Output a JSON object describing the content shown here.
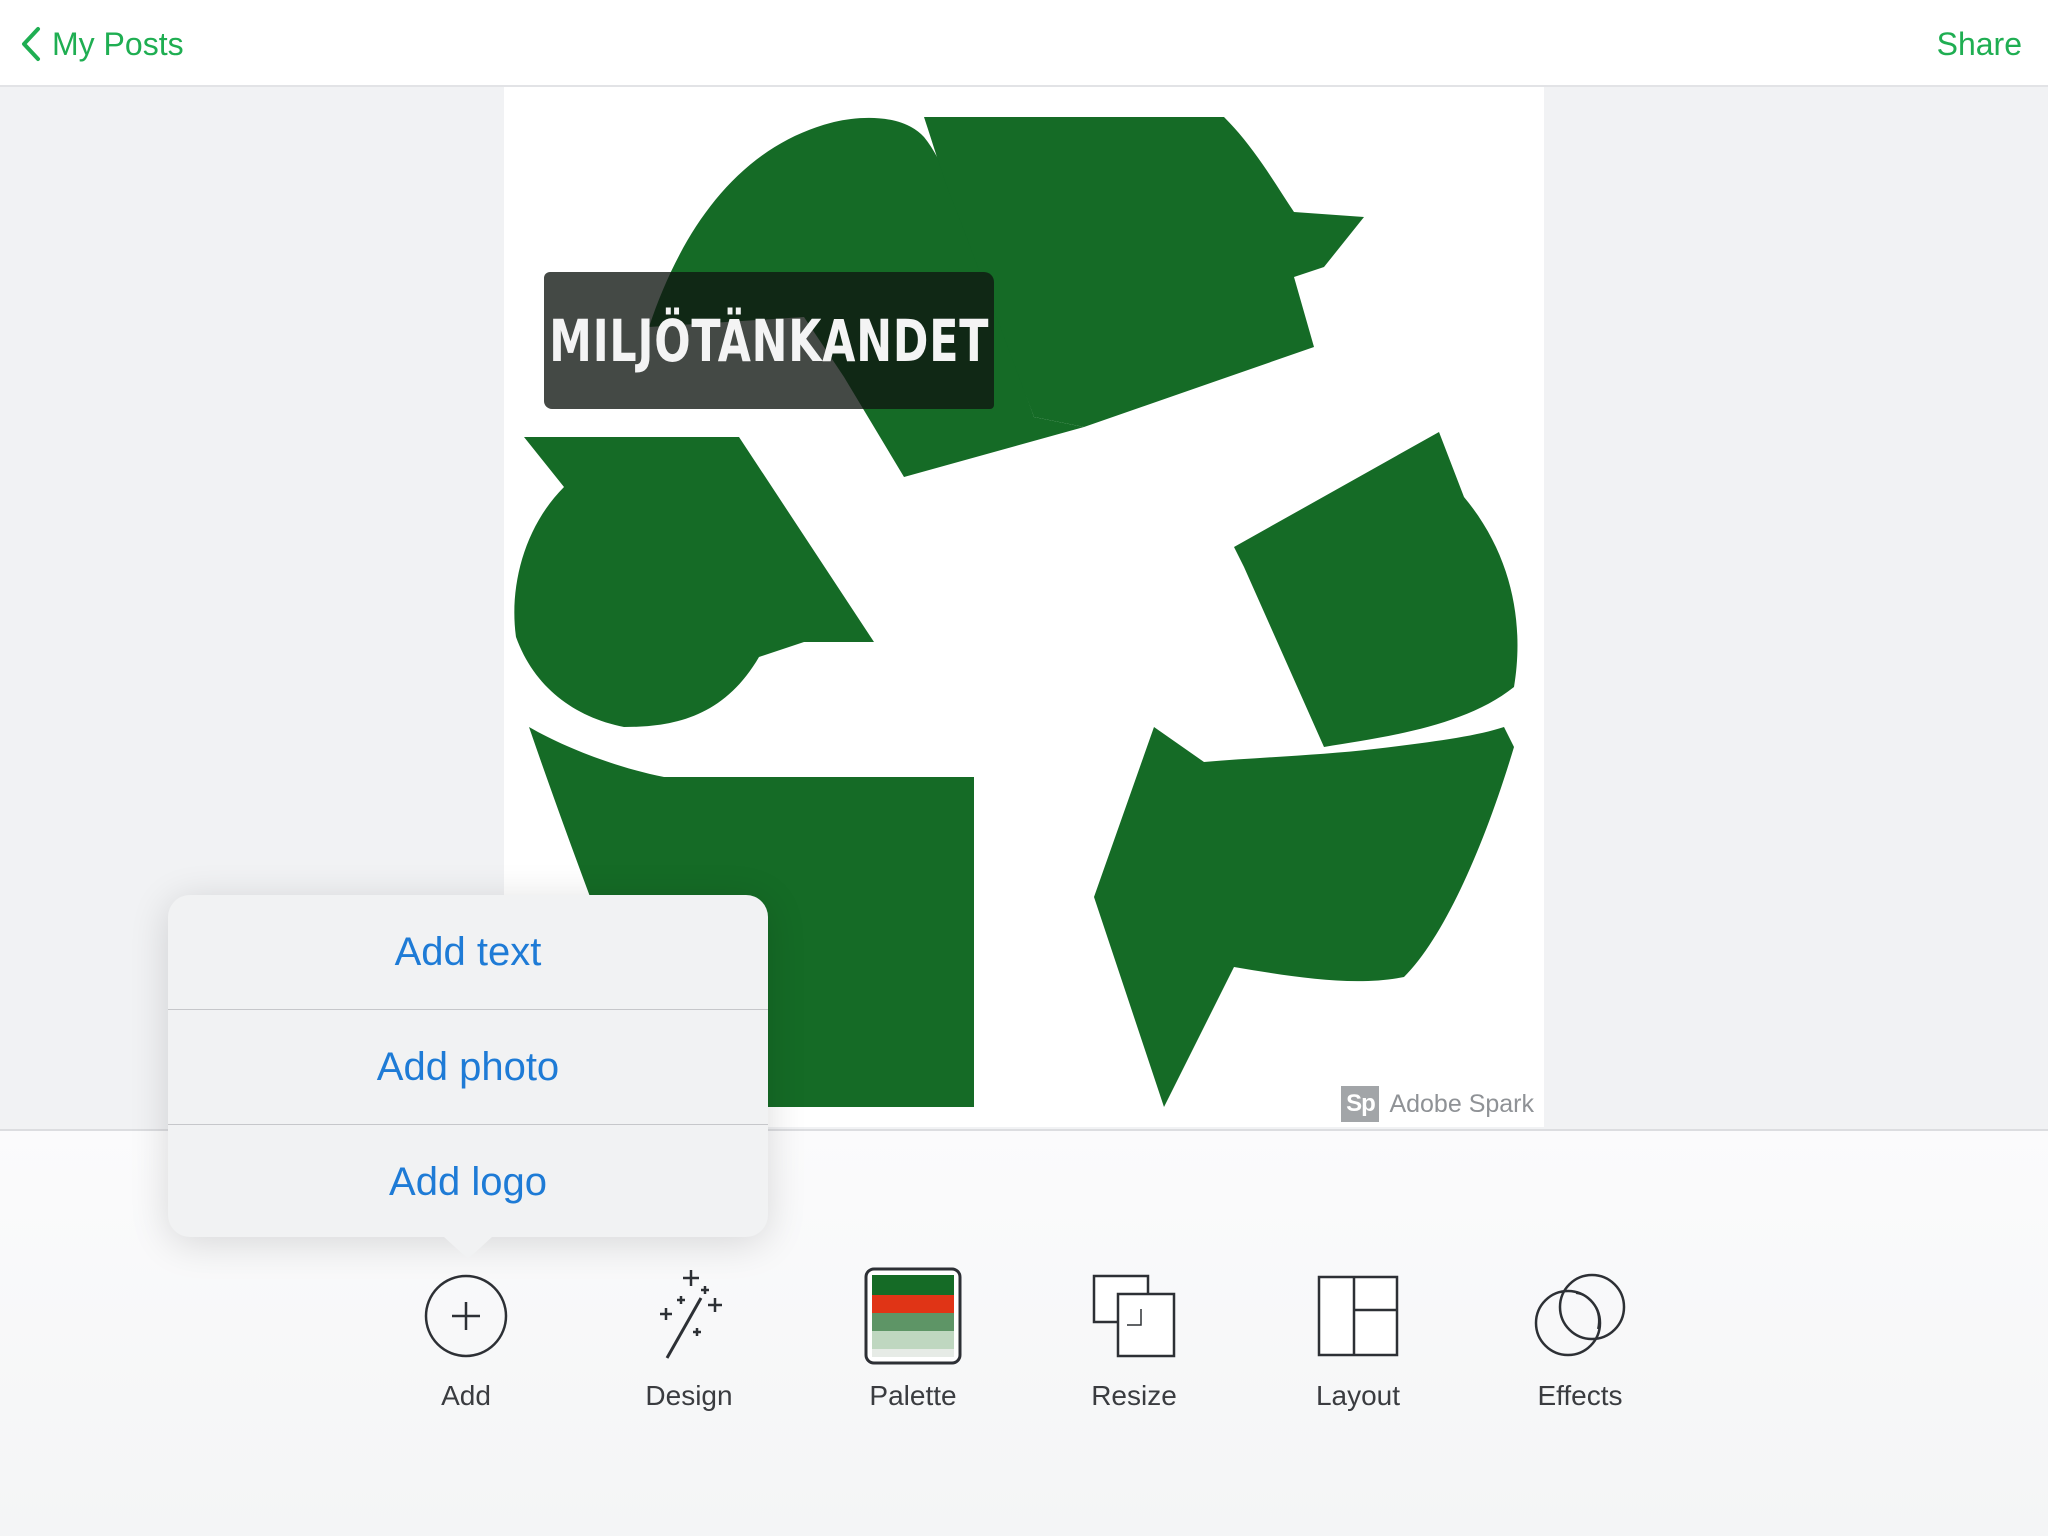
{
  "nav": {
    "back_label": "My Posts",
    "share_label": "Share"
  },
  "canvas": {
    "title_text": "MILJÖTÄNKANDET",
    "watermark_logo": "Sp",
    "watermark_text": "Adobe Spark",
    "image_icon": "recycle-symbol",
    "colors": {
      "recycle_green": "#156b26",
      "title_bg": "#1f2a22"
    }
  },
  "add_menu": {
    "items": [
      {
        "label": "Add text"
      },
      {
        "label": "Add photo"
      },
      {
        "label": "Add logo"
      }
    ]
  },
  "toolbar": {
    "tools": [
      {
        "label": "Add",
        "icon": "plus-circle-icon"
      },
      {
        "label": "Design",
        "icon": "magic-wand-icon"
      },
      {
        "label": "Palette",
        "icon": "palette-icon"
      },
      {
        "label": "Resize",
        "icon": "resize-icon"
      },
      {
        "label": "Layout",
        "icon": "layout-icon"
      },
      {
        "label": "Effects",
        "icon": "effects-icon"
      }
    ],
    "palette_colors": [
      "#156b26",
      "#e03416",
      "#5e9566",
      "#bfd7c0"
    ]
  },
  "colors": {
    "accent_green": "#1fae52",
    "menu_blue": "#1e7bd6"
  }
}
